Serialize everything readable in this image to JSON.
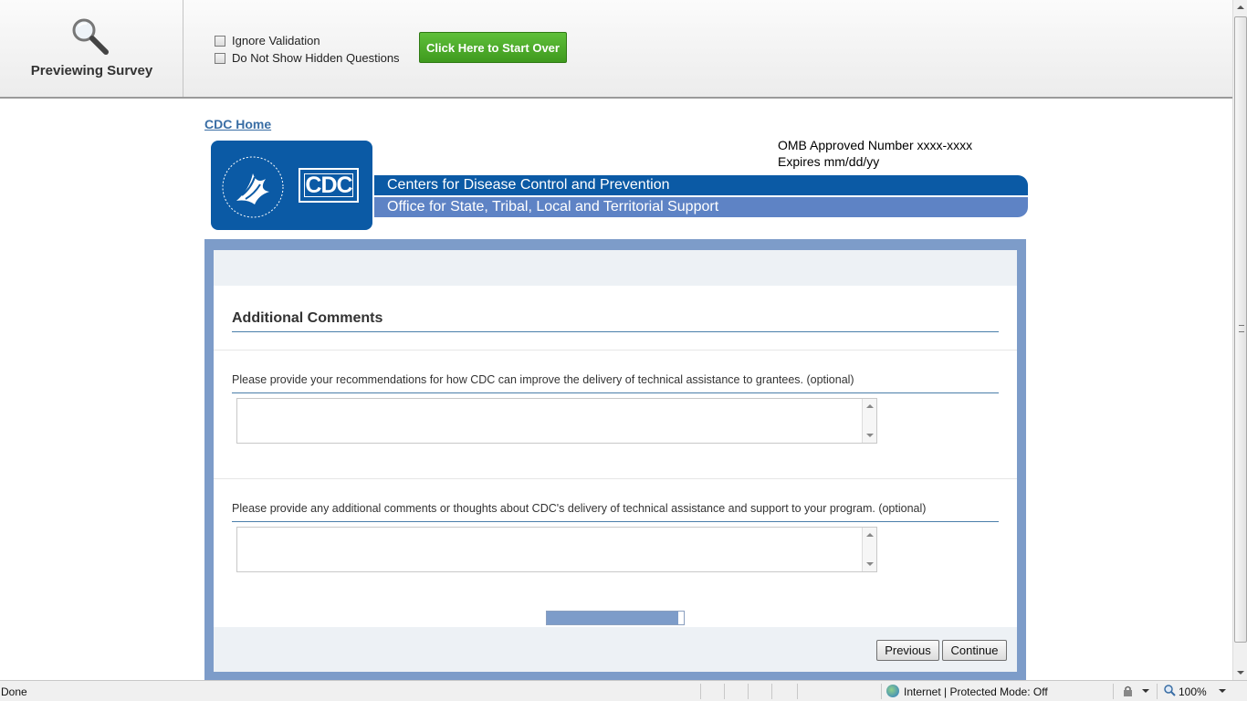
{
  "preview": {
    "title": "Previewing Survey",
    "ignore_validation": "Ignore Validation",
    "hide_hidden": "Do Not Show Hidden Questions",
    "start_over": "Click Here to Start Over"
  },
  "page": {
    "home_link": "CDC Home",
    "omb_line1": "OMB Approved Number xxxx-xxxx",
    "omb_line2": "Expires mm/dd/yy",
    "logo_text": "CDC",
    "banner_top": "Centers for Disease Control and Prevention",
    "banner_bottom": "Office for State, Tribal, Local and Territorial Support"
  },
  "survey": {
    "section_title": "Additional Comments",
    "q1": "Please provide your recommendations for how CDC can improve the delivery of technical assistance to grantees.  (optional)",
    "q1_value": "",
    "q2": "Please provide any additional comments or thoughts about CDC's delivery of technical assistance and support to your program.  (optional)",
    "q2_value": "",
    "progress_fraction": 0.96,
    "previous": "Previous",
    "continue": "Continue"
  },
  "status": {
    "left": "Done",
    "zone": "Internet | Protected Mode: Off",
    "zoom": "100%"
  },
  "colors": {
    "cdc_blue": "#0b5aa5",
    "cdc_light_blue": "#5e83c5",
    "frame": "#7d9cc9",
    "start_over_green": "#4aa828"
  }
}
